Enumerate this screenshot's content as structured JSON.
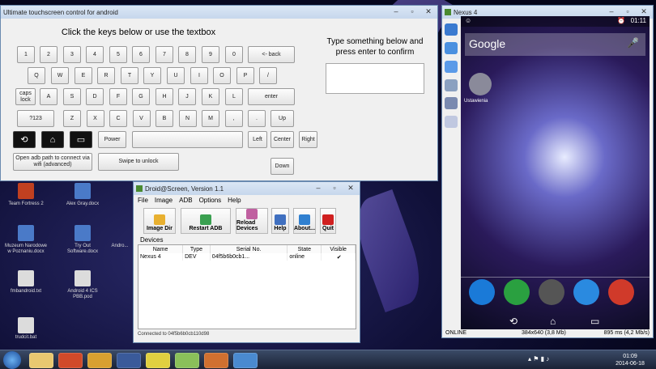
{
  "keyboard": {
    "title": "Ultimate touchscreen control for android",
    "header": "Click the keys below or use the textbox",
    "type_header": "Type something below and press enter to confirm",
    "rows": [
      [
        "1",
        "2",
        "3",
        "4",
        "5",
        "6",
        "7",
        "8",
        "9",
        "0",
        "<- back"
      ],
      [
        "Q",
        "W",
        "E",
        "R",
        "T",
        "Y",
        "U",
        "I",
        "O",
        "P",
        "/"
      ],
      [
        "caps lock",
        "A",
        "S",
        "D",
        "F",
        "G",
        "H",
        "J",
        "K",
        "L",
        "enter"
      ],
      [
        "?123",
        "Z",
        "X",
        "C",
        "V",
        "B",
        "N",
        "M",
        ",",
        ".",
        "Up"
      ]
    ],
    "power": "Power",
    "left": "Left",
    "center": "Center",
    "right": "Right",
    "down": "Down",
    "adb_path": "Open adb path to connect via wifi (advanced)",
    "swipe": "Swipe to unlock"
  },
  "droid": {
    "title": "Droid@Screen, Version 1.1",
    "menu": [
      "File",
      "Image",
      "ADB",
      "Options",
      "Help"
    ],
    "tools": [
      {
        "label": "Image Dir",
        "color": "#e8b030"
      },
      {
        "label": "Restart ADB",
        "color": "#3aa050"
      },
      {
        "label": "Reload Devices",
        "color": "#c060a0"
      },
      {
        "label": "Help",
        "color": "#4070c0"
      },
      {
        "label": "About...",
        "color": "#3080d0"
      },
      {
        "label": "Quit",
        "color": "#d02020"
      }
    ],
    "devices_label": "Devices",
    "columns": [
      "Name",
      "Type",
      "Serial No.",
      "State",
      "Visible"
    ],
    "row": {
      "name": "Nexus 4",
      "type": "DEV",
      "serial": "04f5b6b0cb1...",
      "state": "online",
      "visible": "✔"
    },
    "status": "Connected to 04f5b6b0cb110d98"
  },
  "phone": {
    "title": "Nexus 4",
    "time": "01:11",
    "search": "Google",
    "app_label": "Ustawienia",
    "status_left": "ONLINE",
    "status_mid": "384x640 (3,8 Mb)",
    "status_right": "895 ms (4,2 Mb/s)"
  },
  "desktop": {
    "icons": [
      "Team Fortress 2",
      "Alex Gray.docx",
      "Muzeum Narodowe w Poznaniu.docx",
      "Try Out Software.docx",
      "Andro...",
      "fmbandroid.txt",
      "Android 4 ICS PBB.pod",
      "trudcit.bat"
    ]
  },
  "taskbar": {
    "time": "01:09",
    "date": "2014-06-18"
  }
}
